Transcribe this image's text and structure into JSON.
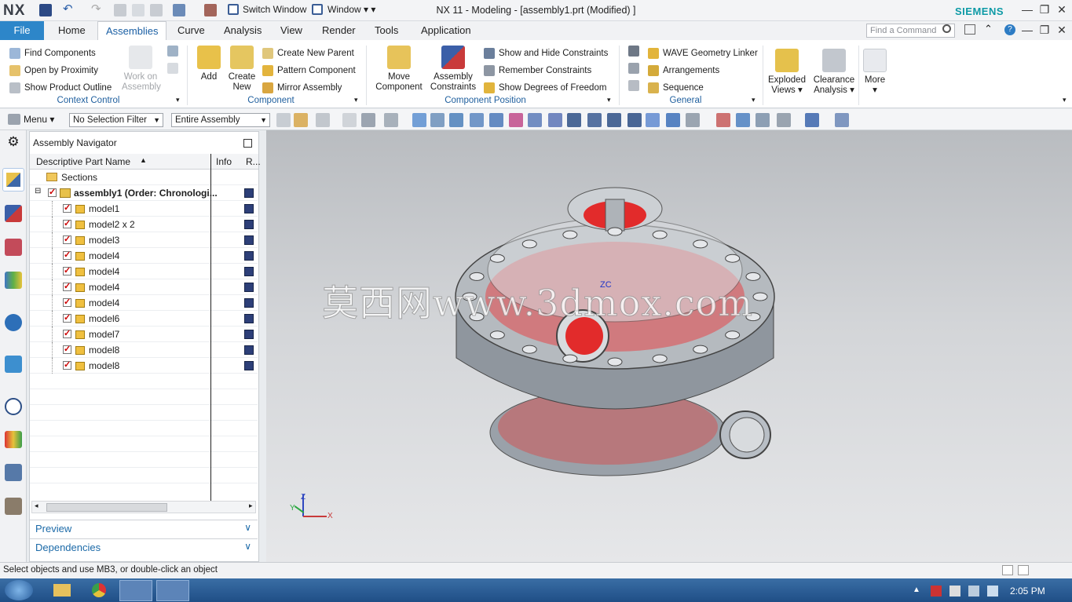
{
  "titlebar": {
    "app": "NX",
    "switch_window": "Switch Window",
    "window_menu": "Window",
    "title": "NX 11 - Modeling - [assembly1.prt (Modified) ]",
    "brand": "SIEMENS"
  },
  "tabs": {
    "file": "File",
    "items": [
      "Home",
      "Assemblies",
      "Curve",
      "Analysis",
      "View",
      "Render",
      "Tools",
      "Application"
    ],
    "active": "Assemblies",
    "find_placeholder": "Find a Command"
  },
  "ribbon": {
    "context_control": {
      "label": "Context Control",
      "items": [
        "Find Components",
        "Open by Proximity",
        "Show Product Outline"
      ],
      "work_on_assembly": [
        "Work on",
        "Assembly"
      ]
    },
    "component": {
      "label": "Component",
      "add": "Add",
      "create_new": [
        "Create",
        "New"
      ],
      "items": [
        "Create New Parent",
        "Pattern Component",
        "Mirror Assembly"
      ]
    },
    "component_position": {
      "label": "Component Position",
      "move_component": [
        "Move",
        "Component"
      ],
      "assembly_constraints": [
        "Assembly",
        "Constraints"
      ],
      "items": [
        "Show and Hide Constraints",
        "Remember Constraints",
        "Show Degrees of Freedom"
      ]
    },
    "general": {
      "label": "General",
      "items": [
        "WAVE Geometry Linker",
        "Arrangements",
        "Sequence"
      ]
    },
    "exploded_views": [
      "Exploded",
      "Views"
    ],
    "clearance_analysis": [
      "Clearance",
      "Analysis"
    ],
    "more": "More"
  },
  "selection_bar": {
    "menu": "Menu",
    "filter": "No Selection Filter",
    "scope": "Entire Assembly"
  },
  "navigator": {
    "title": "Assembly Navigator",
    "columns": [
      "Descriptive Part Name",
      "Info",
      "R..."
    ],
    "sections": "Sections",
    "root": "assembly1 (Order: Chronologi...",
    "parts": [
      "model1",
      "model2 x 2",
      "model3",
      "model4",
      "model4",
      "model4",
      "model4",
      "model6",
      "model7",
      "model8",
      "model8"
    ],
    "preview": "Preview",
    "dependencies": "Dependencies"
  },
  "viewport": {
    "watermark": "莫西网www.3dmox.com",
    "zc_label": "ZC",
    "triad": {
      "z": "Z",
      "y": "Y",
      "x": "X"
    }
  },
  "status": "Select objects and use MB3, or double-click an object",
  "taskbar": {
    "time": "2:05 PM"
  },
  "colors": {
    "accent": "#2d86c9",
    "brand": "#0d9aa6",
    "model_red": "#e22b2b"
  }
}
